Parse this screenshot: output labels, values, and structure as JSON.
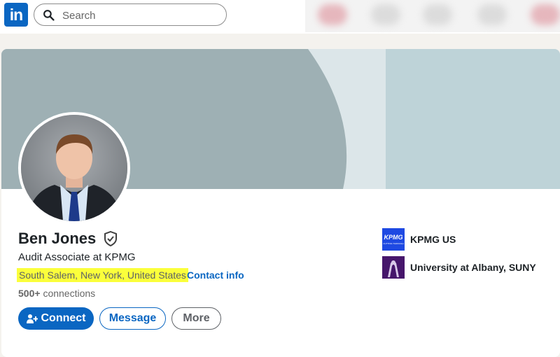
{
  "nav": {
    "logo_text": "in",
    "search_placeholder": "Search"
  },
  "profile": {
    "name": "Ben Jones",
    "headline": "Audit Associate at KPMG",
    "location": "South Salem, New York, United States",
    "separator": "·",
    "contact_info": "Contact info",
    "connections_count": "500+",
    "connections_label": "connections"
  },
  "actions": {
    "connect": "Connect",
    "message": "Message",
    "more": "More"
  },
  "organizations": [
    {
      "name": "KPMG US",
      "logo_text": "KPMG",
      "logo_subtext": "CUTTING THROUGH"
    },
    {
      "name": "University at Albany, SUNY"
    }
  ],
  "colors": {
    "brand": "#0a66c2",
    "highlight": "#fbff3b",
    "banner_dark": "#9eb0b4",
    "banner_light": "#dce6e9",
    "banner_right": "#bed3d8",
    "kpmg_blue": "#1e49e2",
    "ualbany_purple": "#46166b"
  },
  "icons": [
    "search-icon",
    "verified-shield-icon",
    "connect-person-plus-icon"
  ]
}
